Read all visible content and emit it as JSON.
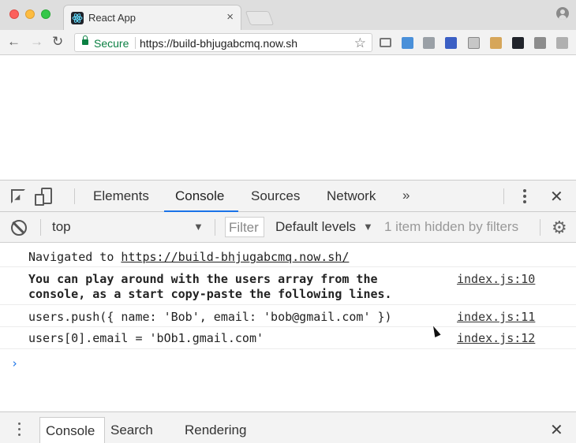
{
  "browser": {
    "tab_title": "React App",
    "tab_close": "×",
    "address": {
      "secure_label": "Secure",
      "url": "https://build-bhjugabcmq.now.sh"
    },
    "nav": {
      "back": "←",
      "forward": "→",
      "reload": "↻",
      "star": "☆"
    }
  },
  "devtools": {
    "tabs": [
      {
        "label": "Elements",
        "active": false
      },
      {
        "label": "Console",
        "active": true
      },
      {
        "label": "Sources",
        "active": false
      },
      {
        "label": "Network",
        "active": false
      }
    ],
    "more_tabs": "»",
    "close": "✕",
    "filter_bar": {
      "context": "top",
      "filter_placeholder": "Filter",
      "levels": "Default levels",
      "hidden_count": "1 item hidden by filters"
    },
    "console": {
      "navigated_prefix": "Navigated to ",
      "navigated_url": "https://build-bhjugabcmq.now.sh/",
      "messages": [
        {
          "text": "You can play around with the users array from the\nconsole, as a start copy-paste the following lines.",
          "source": "index.js:10"
        },
        {
          "text": "users.push({ name: 'Bob', email: 'bob@gmail.com' })",
          "source": "index.js:11"
        },
        {
          "text": "users[0].email = 'bOb1.gmail.com'",
          "source": "index.js:12"
        }
      ],
      "prompt": "›"
    },
    "drawer": {
      "tabs": [
        {
          "label": "Console",
          "active": true
        },
        {
          "label": "Search",
          "active": false
        },
        {
          "label": "Rendering",
          "active": false
        }
      ],
      "close": "✕"
    }
  },
  "colors": {
    "accent": "#1a73e8",
    "secure_green": "#0b8043"
  }
}
